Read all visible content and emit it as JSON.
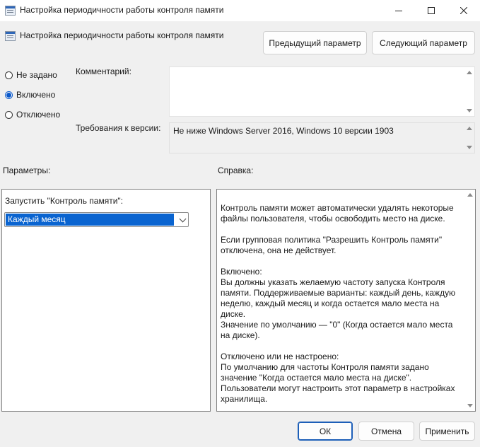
{
  "window": {
    "title": "Настройка периодичности работы контроля памяти"
  },
  "header": {
    "policy_title": "Настройка периодичности работы контроля памяти",
    "prev_button": "Предыдущий параметр",
    "next_button": "Следующий параметр"
  },
  "state": {
    "options": [
      {
        "label": "Не задано",
        "checked": false
      },
      {
        "label": "Включено",
        "checked": true
      },
      {
        "label": "Отключено",
        "checked": false
      }
    ]
  },
  "comment": {
    "label": "Комментарий:",
    "value": ""
  },
  "requirements": {
    "label": "Требования к версии:",
    "value": "Не ниже Windows Server 2016, Windows 10 версии 1903"
  },
  "options_panel": {
    "heading": "Параметры:",
    "field_label": "Запустить \"Контроль памяти\":",
    "selected_value": "Каждый месяц"
  },
  "help_panel": {
    "heading": "Справка:",
    "text": "Контроль памяти может автоматически удалять некоторые файлы пользователя, чтобы освободить место на диске.\n\nЕсли групповая политика \"Разрешить Контроль памяти\" отключена, она не действует.\n\nВключено:\nВы должны указать желаемую частоту запуска Контроля памяти. Поддерживаемые варианты: каждый день, каждую неделю, каждый месяц и когда остается мало места на диске.\nЗначение по умолчанию — \"0\" (Когда остается мало места на диске).\n\nОтключено или не настроено:\nПо умолчанию для частоты Контроля памяти задано значение \"Когда остается мало места на диске\".\nПользователи могут настроить этот параметр в настройках хранилища."
  },
  "footer": {
    "ok": "ОК",
    "cancel": "Отмена",
    "apply": "Применить"
  },
  "colors": {
    "accent": "#0a64d0",
    "background": "#f0f0f0"
  }
}
